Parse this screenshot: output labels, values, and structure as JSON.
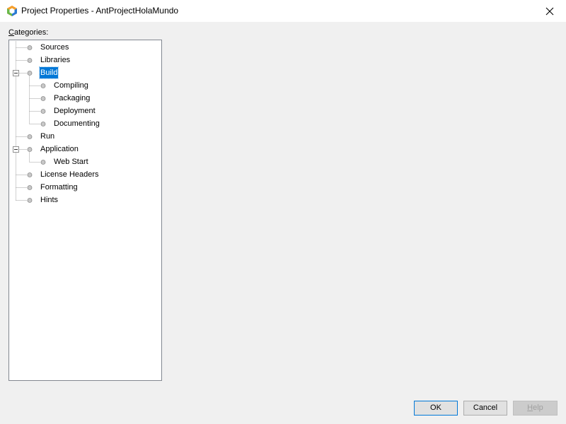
{
  "window": {
    "title": "Project Properties - AntProjectHolaMundo",
    "close_icon": "close-icon",
    "app_icon": "netbeans-icon"
  },
  "categories": {
    "label_prefix": "C",
    "label_rest": "ategories:",
    "tree": [
      {
        "label": "Sources",
        "level": 0
      },
      {
        "label": "Libraries",
        "level": 0
      },
      {
        "label": "Build",
        "level": 0,
        "expanded": true,
        "selected": true
      },
      {
        "label": "Compiling",
        "level": 1
      },
      {
        "label": "Packaging",
        "level": 1
      },
      {
        "label": "Deployment",
        "level": 1
      },
      {
        "label": "Documenting",
        "level": 1
      },
      {
        "label": "Run",
        "level": 0
      },
      {
        "label": "Application",
        "level": 0,
        "expanded": true
      },
      {
        "label": "Web Start",
        "level": 1
      },
      {
        "label": "License Headers",
        "level": 0
      },
      {
        "label": "Formatting",
        "level": 0
      },
      {
        "label": "Hints",
        "level": 0
      }
    ]
  },
  "buttons": {
    "ok": "OK",
    "cancel": "Cancel",
    "help_mnemonic": "H",
    "help_rest": "elp"
  },
  "colors": {
    "selection": "#0078d7",
    "dialog_bg": "#f0f0f0"
  }
}
